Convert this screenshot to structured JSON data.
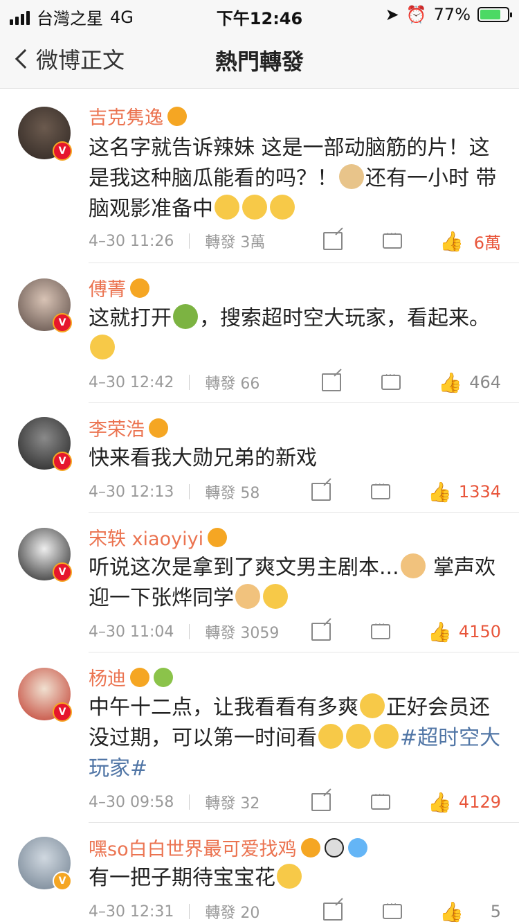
{
  "status": {
    "carrier": "台灣之星",
    "network": "4G",
    "time": "下午12:46",
    "battery": "77%",
    "battery_level": 0.77
  },
  "nav": {
    "back_label": "微博正文",
    "title": "熱門轉發"
  },
  "comments": [
    {
      "name": "吉克隽逸",
      "text_parts": [
        "这名字就告诉辣妹 这是一部动脑筋的片！这是我这种脑瓜能看的吗？！",
        "还有一小时 带脑观影准备中"
      ],
      "time": "4–30 11:26",
      "repost": "轉發 3萬",
      "likes": "6萬",
      "liked": true
    },
    {
      "name": "傅菁",
      "text_parts": [
        "这就打开",
        "，搜索超时空大玩家，看起来。"
      ],
      "time": "4–30 12:42",
      "repost": "轉發 66",
      "likes": "464",
      "liked": false
    },
    {
      "name": "李荣浩",
      "text_parts": [
        "快来看我大勋兄弟的新戏"
      ],
      "time": "4–30 12:13",
      "repost": "轉發 58",
      "likes": "1334",
      "liked": true
    },
    {
      "name": "宋轶 xiaoyiyi",
      "text_parts": [
        "听说这次是拿到了爽文男主剧本...",
        " 掌声欢迎一下张烨同学"
      ],
      "time": "4–30 11:04",
      "repost": "轉發 3059",
      "likes": "4150",
      "liked": true
    },
    {
      "name": "杨迪",
      "text_parts": [
        "中午十二点，让我看看有多爽",
        "正好会员还没过期，可以第一时间看"
      ],
      "tag": "#超时空大玩家#",
      "time": "4–30 09:58",
      "repost": "轉發 32",
      "likes": "4129",
      "liked": true
    },
    {
      "name": "嘿so白白世界最可爱找鸡",
      "text_parts": [
        "有一把子期待宝宝花"
      ],
      "time": "4–30 12:31",
      "repost": "轉發 20",
      "likes": "5",
      "liked": false
    }
  ],
  "colors": {
    "name": "#eb7350",
    "like_active": "#e8553a",
    "hashtag": "#5176a6",
    "meta": "#999999"
  }
}
